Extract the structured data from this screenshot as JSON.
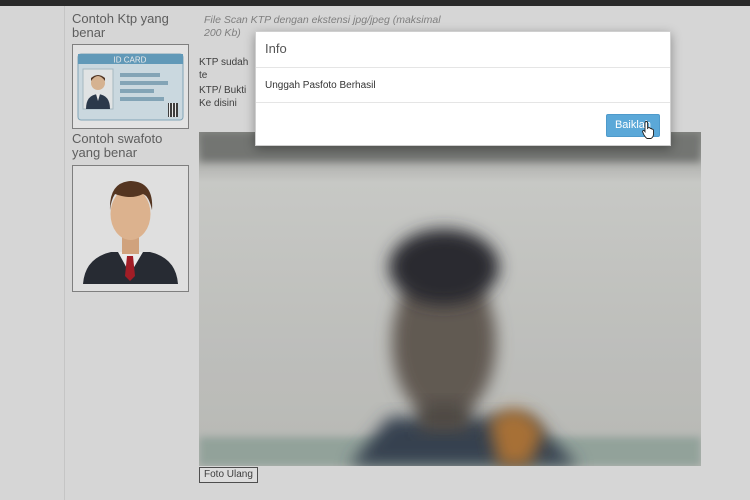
{
  "examples": {
    "ktp_label": "Contoh Ktp yang benar",
    "ktp_card_text": "ID CARD",
    "selfie_label": "Contoh swafoto yang benar"
  },
  "notes": {
    "scan_info": "File Scan KTP dengan ekstensi jpg/jpeg (maksimal 200 Kb)",
    "ktp_uploaded": "KTP sudah te",
    "ktp_proof": "KTP/ Bukti Ke disini"
  },
  "camera": {
    "retake_label": "Foto Ulang"
  },
  "modal": {
    "title": "Info",
    "message": "Unggah Pasfoto Berhasil",
    "ok_label": "Baiklah"
  },
  "colors": {
    "accent": "#5ba8d8",
    "top_strip": "#2e2e2e"
  },
  "icons": [
    "id-card-icon",
    "person-avatar-icon",
    "hand-pointer-icon"
  ]
}
